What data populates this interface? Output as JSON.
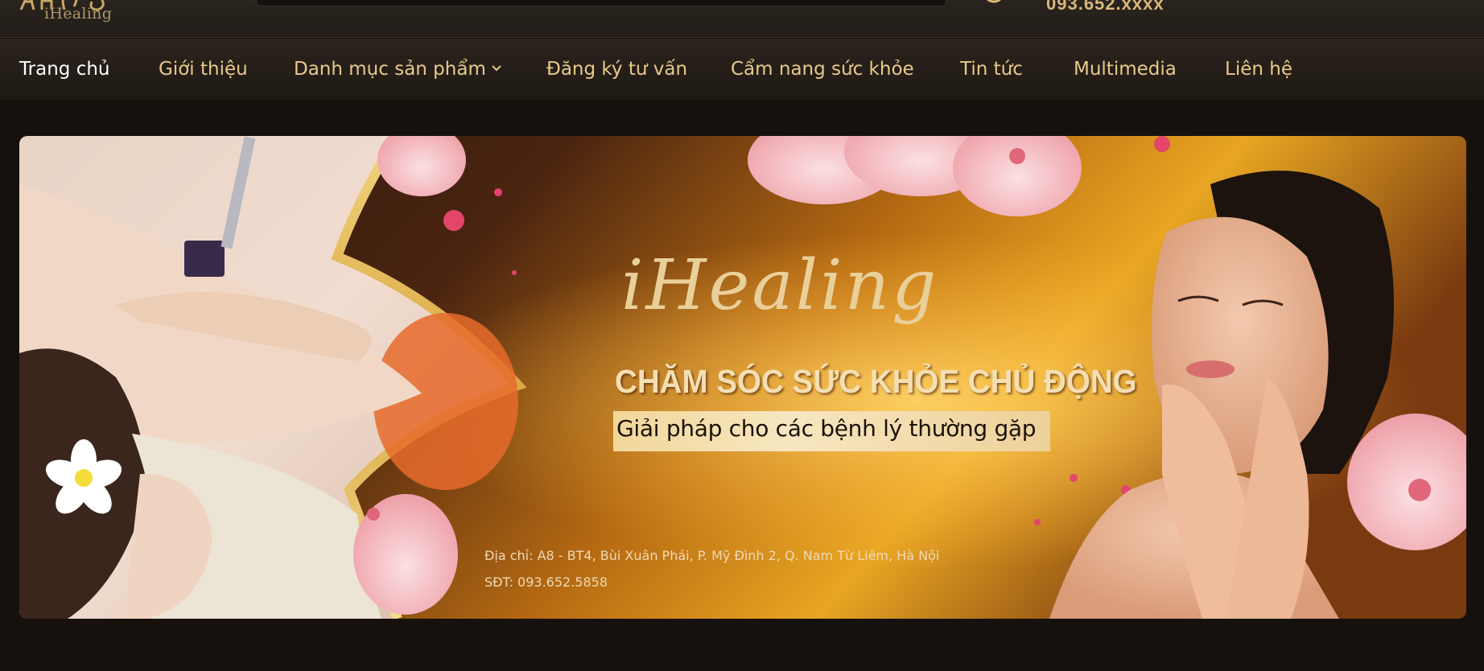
{
  "header": {
    "logo_text": "iHealing",
    "phone_partial": "093.652.xxxx"
  },
  "nav": {
    "items": [
      {
        "label": "Trang chủ",
        "active": true
      },
      {
        "label": "Giới thiệu"
      },
      {
        "label": "Danh mục sản phẩm",
        "has_dropdown": true
      },
      {
        "label": "Đăng ký tư vấn"
      },
      {
        "label": "Cẩm nang sức khỏe"
      },
      {
        "label": "Tin tức"
      },
      {
        "label": "Multimedia"
      },
      {
        "label": "Liên hệ"
      }
    ]
  },
  "banner": {
    "brand": "iHealing",
    "headline": "CHĂM SÓC SỨC KHỎE CHỦ ĐỘNG",
    "subheadline": "Giải pháp cho các bệnh lý thường gặp",
    "address": "Địa chỉ: A8 - BT4, Bùi Xuân Phái, P. Mỹ Đình 2, Q. Nam Từ Liêm, Hà Nội",
    "phone": "SĐT: 093.652.5858"
  },
  "colors": {
    "page_bg": "#16110d",
    "nav_text": "#e8c98a",
    "nav_active": "#ffffff",
    "gold": "#e5c27a",
    "flower_pink": "#f4b9bf"
  }
}
